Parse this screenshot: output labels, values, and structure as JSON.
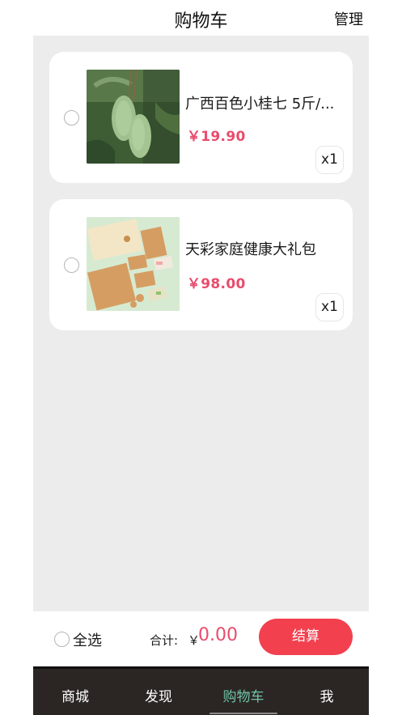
{
  "header": {
    "title": "购物车",
    "manage_label": "管理"
  },
  "cart": {
    "items": [
      {
        "title": "广西百色小桂七 5斤/...",
        "price": "￥19.90",
        "quantity": "x1",
        "image_icon": "mango-photo"
      },
      {
        "title": "天彩家庭健康大礼包",
        "price": "￥98.00",
        "quantity": "x1",
        "image_icon": "gift-box-photo"
      }
    ]
  },
  "checkout": {
    "select_all_label": "全选",
    "total_label": "合计:",
    "currency_symbol": "￥",
    "total_amount": "0.00",
    "pay_label": "结算"
  },
  "tabbar": {
    "tabs": [
      {
        "label": "商城",
        "active": false
      },
      {
        "label": "发现",
        "active": false
      },
      {
        "label": "购物车",
        "active": true
      },
      {
        "label": "我",
        "active": false
      }
    ]
  },
  "colors": {
    "accent_price": "#e84c6c",
    "pay_button": "#f2404f",
    "tab_active": "#6fc3a8",
    "tabbar_bg": "#2b2624",
    "content_bg": "#ececec"
  }
}
